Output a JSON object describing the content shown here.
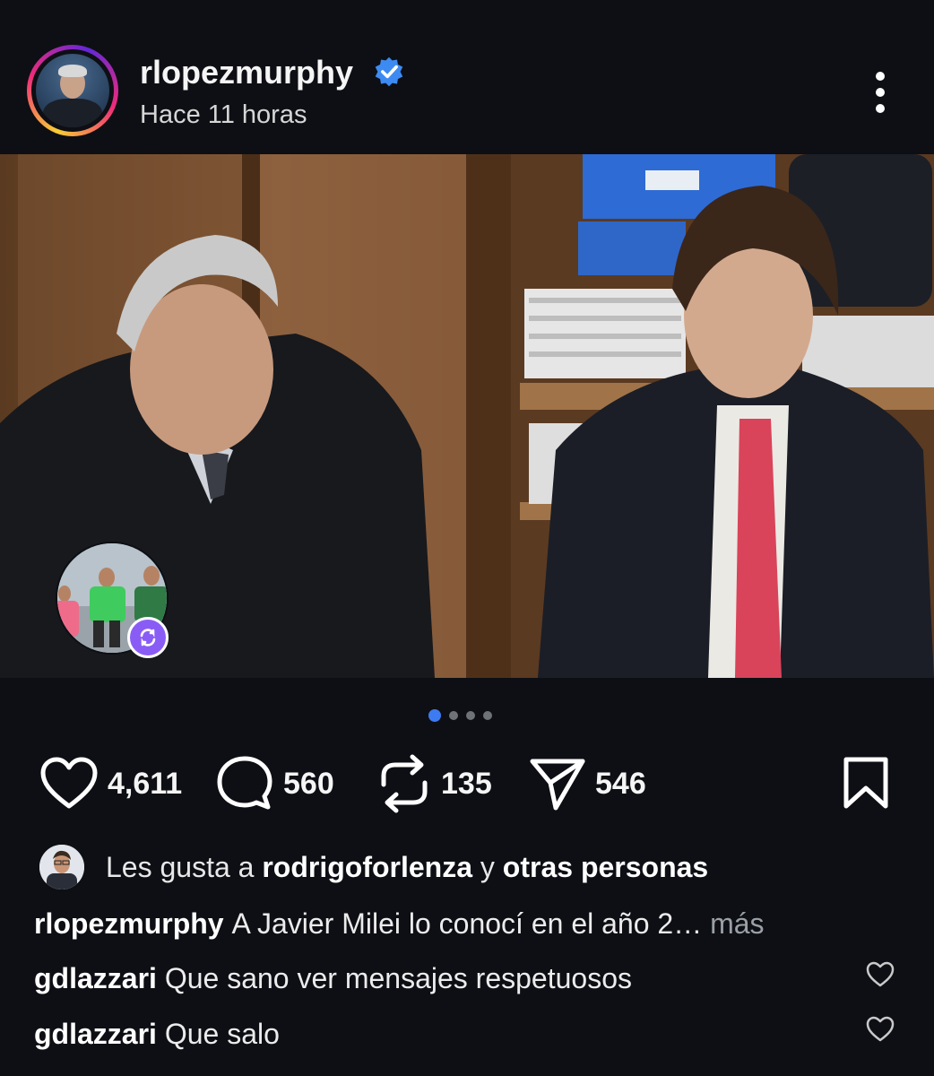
{
  "post": {
    "username": "rlopezmurphy",
    "time": "Hace 11 horas"
  },
  "carousel": {
    "total": 4,
    "active": 1
  },
  "actions": {
    "likes": "4,611",
    "comments": "560",
    "reposts": "135",
    "shares": "546"
  },
  "liked_by": {
    "prefix": "Les gusta a",
    "user": "rodrigoforlenza",
    "joiner": "y",
    "others": "otras personas"
  },
  "caption": {
    "user": "rlopezmurphy",
    "text": "A Javier Milei lo conocí en el año 2…",
    "more": "más"
  },
  "comments": [
    {
      "user": "gdlazzari",
      "text": "Que sano ver mensajes respetuosos"
    },
    {
      "user": "gdlazzari",
      "text": "Que salo"
    }
  ],
  "colors": {
    "background": "#0d0f14",
    "verified": "#3d8bf2",
    "repost_badge": "#8a5cf6",
    "active_dot": "#3d7bf2"
  }
}
